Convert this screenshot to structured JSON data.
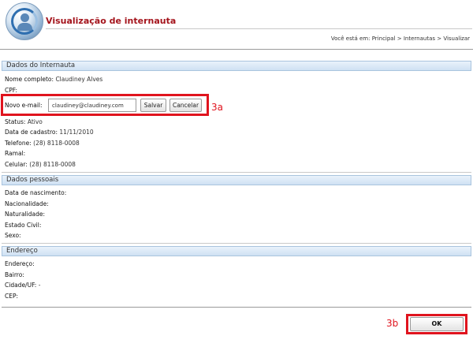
{
  "header": {
    "title": "Visualização de internauta",
    "breadcrumb": "Você está em: Principal > Internautas > Visualizar",
    "logo_icon": "user-globe-icon"
  },
  "internauta": {
    "section_title": "Dados do Internauta",
    "nome_label": "Nome completo:",
    "nome_value": "Claudiney Alves",
    "cpf_label": "CPF:",
    "cpf_value": "",
    "email_label": "Novo e-mail:",
    "email_value": "claudiney@claudiney.com",
    "save_label": "Salvar",
    "cancel_label": "Cancelar",
    "status_label": "Status:",
    "status_value": "Ativo",
    "cadastro_label": "Data de cadastro:",
    "cadastro_value": "11/11/2010",
    "telefone_label": "Telefone:",
    "telefone_value": "(28) 8118-0008",
    "ramal_label": "Ramal:",
    "ramal_value": "",
    "celular_label": "Celular:",
    "celular_value": "(28) 8118-0008"
  },
  "pessoais": {
    "section_title": "Dados pessoais",
    "nascimento_label": "Data de nascimento:",
    "nacionalidade_label": "Nacionalidade:",
    "naturalidade_label": "Naturalidade:",
    "estado_civil_label": "Estado Civil:",
    "sexo_label": "Sexo:"
  },
  "endereco": {
    "section_title": "Endereço",
    "endereco_label": "Endereço:",
    "bairro_label": "Bairro:",
    "cidade_label": "Cidade/UF:",
    "cidade_value": "-",
    "cep_label": "CEP:"
  },
  "annotations": {
    "email_marker": "3a",
    "ok_marker": "3b",
    "callout_color": "#e0141e"
  },
  "footer": {
    "ok_label": "OK"
  }
}
